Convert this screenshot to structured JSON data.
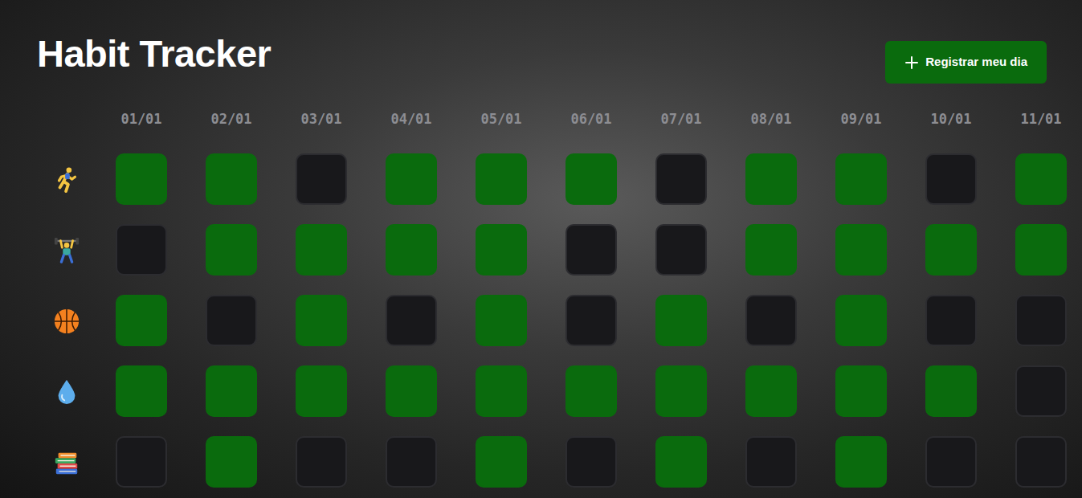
{
  "title": "Habit Tracker",
  "button": {
    "label": "Registrar meu dia"
  },
  "dates": [
    "01/01",
    "02/01",
    "03/01",
    "04/01",
    "05/01",
    "06/01",
    "07/01",
    "08/01",
    "09/01",
    "10/01",
    "11/01"
  ],
  "habits": [
    {
      "days": [
        {
          "done": true
        },
        {
          "done": true
        },
        {
          "done": false
        },
        {
          "done": true
        },
        {
          "done": true
        },
        {
          "done": true
        },
        {
          "done": false
        },
        {
          "done": true
        },
        {
          "done": true
        },
        {
          "done": false
        },
        {
          "done": true
        }
      ]
    },
    {
      "days": [
        {
          "done": false
        },
        {
          "done": true
        },
        {
          "done": true
        },
        {
          "done": true
        },
        {
          "done": true
        },
        {
          "done": false
        },
        {
          "done": false
        },
        {
          "done": true
        },
        {
          "done": true
        },
        {
          "done": true
        },
        {
          "done": true
        }
      ]
    },
    {
      "days": [
        {
          "done": true
        },
        {
          "done": false
        },
        {
          "done": true
        },
        {
          "done": false
        },
        {
          "done": true
        },
        {
          "done": false
        },
        {
          "done": true
        },
        {
          "done": false
        },
        {
          "done": true
        },
        {
          "done": false
        },
        {
          "done": false
        }
      ]
    },
    {
      "days": [
        {
          "done": true
        },
        {
          "done": true
        },
        {
          "done": true
        },
        {
          "done": true
        },
        {
          "done": true
        },
        {
          "done": true
        },
        {
          "done": true
        },
        {
          "done": true
        },
        {
          "done": true
        },
        {
          "done": true
        },
        {
          "done": false
        }
      ]
    },
    {
      "days": [
        {
          "done": false
        },
        {
          "done": true
        },
        {
          "done": false
        },
        {
          "done": false
        },
        {
          "done": true
        },
        {
          "done": false
        },
        {
          "done": true
        },
        {
          "done": false
        },
        {
          "done": true
        },
        {
          "done": false
        },
        {
          "done": false
        }
      ]
    }
  ]
}
